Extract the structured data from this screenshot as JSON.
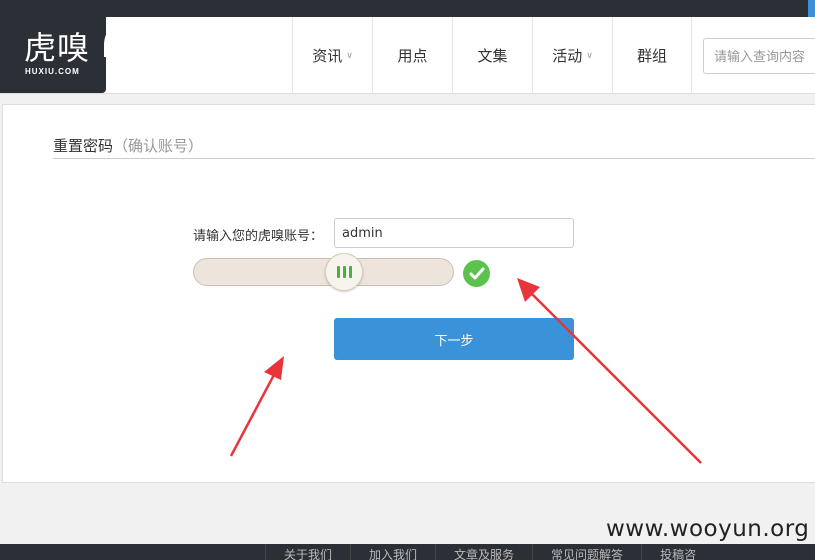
{
  "logo": {
    "title": "虎嗅",
    "subtitle": "HUXIU.COM"
  },
  "nav": {
    "items": [
      {
        "label": "资讯",
        "has_dropdown": true
      },
      {
        "label": "用点",
        "has_dropdown": false
      },
      {
        "label": "文集",
        "has_dropdown": false
      },
      {
        "label": "活动",
        "has_dropdown": true
      },
      {
        "label": "群组",
        "has_dropdown": false
      }
    ]
  },
  "search": {
    "placeholder": "请输入查询内容"
  },
  "form": {
    "title": "重置密码",
    "subtitle": "（确认账号）",
    "account_label": "请输入您的虎嗅账号：",
    "account_value": "admin",
    "slider_state": "verified",
    "next_label": "下一步"
  },
  "watermark": "www.wooyun.org",
  "footer": {
    "links": [
      "关于我们",
      "加入我们",
      "文章及服务",
      "常见问题解答",
      "投稿咨"
    ]
  },
  "colors": {
    "accent": "#3a93d8",
    "success": "#5cc24e",
    "dark": "#2b2f36",
    "annotation_arrow": "#e8343a"
  }
}
